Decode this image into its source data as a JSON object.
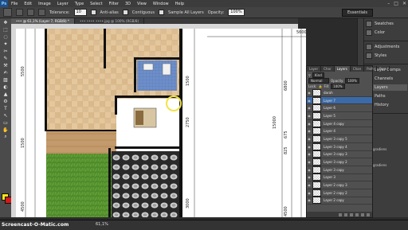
{
  "app": {
    "logo": "Ps",
    "menus": [
      "File",
      "Edit",
      "Image",
      "Layer",
      "Type",
      "Select",
      "Filter",
      "3D",
      "View",
      "Window",
      "Help"
    ],
    "window_controls": [
      "–",
      "□",
      "✕"
    ],
    "workspace": "Essentials"
  },
  "options_bar": {
    "tolerance_label": "Tolerance:",
    "tolerance_value": "10",
    "antialias_label": "Anti-alias",
    "contiguous_label": "Contiguous",
    "sample_all_label": "Sample All Layers",
    "opacity_label": "Opacity:",
    "opacity_value": "100%"
  },
  "tabs": [
    {
      "label": "••• @ 61,1% (Layer 7, RGB/8) *",
      "active": true
    },
    {
      "label": "••• •••• ••••.jpg @ 100% (RGB/8)",
      "active": false
    }
  ],
  "tools": [
    "❖",
    "⬚",
    "◌",
    "✦",
    "✂",
    "✎",
    "⚒",
    "✍",
    "▨",
    "◐",
    "▲",
    "⚙",
    "T",
    "↖",
    "▭",
    "✋",
    "⌕"
  ],
  "canvas": {
    "dims_left": [
      "5500",
      "15000",
      "1500",
      "4500"
    ],
    "dims_mid": [
      "1500",
      "2750"
    ],
    "dims_right": [
      "6800",
      "15000",
      "675",
      "825",
      "3000",
      "4500"
    ],
    "dims_far": [
      "5600"
    ]
  },
  "status": {
    "zoom": "61,1%",
    "watermark": "Screencast-O-Matic.com"
  },
  "mini_panels": {
    "group1": [
      {
        "icon": "swatches-icon",
        "label": "Swatches"
      },
      {
        "icon": "color-icon",
        "label": "Color"
      }
    ],
    "group2": [
      {
        "icon": "adjustments-icon",
        "label": "Adjustments"
      },
      {
        "icon": "styles-icon",
        "label": "Styles"
      }
    ],
    "group3": [
      {
        "icon": "layer-comps-icon",
        "label": "Layer Comps"
      },
      {
        "icon": "channels-icon",
        "label": "Channels"
      },
      {
        "icon": "layers-icon",
        "label": "Layers"
      },
      {
        "icon": "paths-icon",
        "label": "Paths"
      },
      {
        "icon": "history-icon",
        "label": "History"
      }
    ]
  },
  "layers_panel": {
    "tabs": [
      "Layer",
      "Char",
      "Layers",
      "Chan",
      "Path",
      "Para"
    ],
    "filter_kind": "Kind",
    "blend_mode": "Normal",
    "opacity_label": "Opacity:",
    "opacity_value": "100%",
    "lock_label": "Lock:",
    "fill_label": "Fill:",
    "fill_value": "100%",
    "layers": [
      {
        "name": "darah",
        "selected": false
      },
      {
        "name": "Layer 7",
        "selected": true
      },
      {
        "name": "Layer 6",
        "selected": false
      },
      {
        "name": "Layer 5",
        "selected": false
      },
      {
        "name": "Layer 4 copy",
        "selected": false
      },
      {
        "name": "Layer 4",
        "selected": false
      },
      {
        "name": "Layer 3 copy 5",
        "selected": false
      },
      {
        "name": "Layer 3 copy 4",
        "selected": false
      },
      {
        "name": "Layer 3 copy 3",
        "selected": false
      },
      {
        "name": "Layer 3 copy 2",
        "selected": false
      },
      {
        "name": "Layer 3 copy",
        "selected": false
      },
      {
        "name": "Layer 3",
        "selected": false
      },
      {
        "name": "Layer 2 copy 3",
        "selected": false
      },
      {
        "name": "Layer 2 copy 2",
        "selected": false
      },
      {
        "name": "Layer 2 copy",
        "selected": false
      }
    ],
    "side_labels": [
      "gradiens",
      "",
      "gradiens"
    ]
  }
}
